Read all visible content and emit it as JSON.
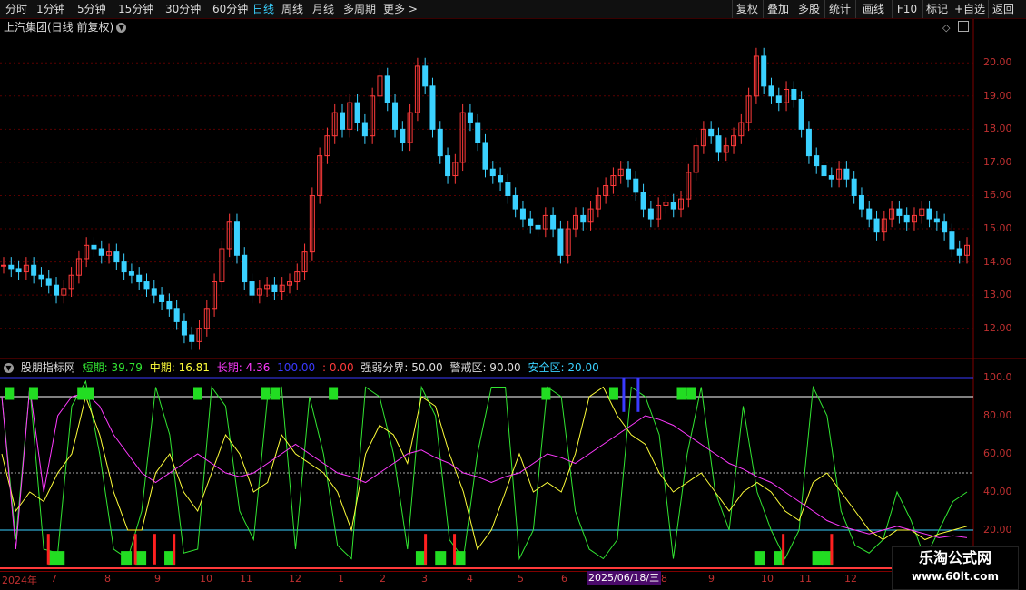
{
  "toolbar": {
    "periods": [
      "分时",
      "1分钟",
      "5分钟",
      "15分钟",
      "30分钟",
      "60分钟",
      "日线",
      "周线",
      "月线",
      "多周期",
      "更多 >"
    ],
    "active": "日线",
    "right_buttons": [
      "复权",
      "叠加",
      "多股",
      "统计",
      "画线",
      "F10",
      "标记",
      "+自选",
      "返回"
    ]
  },
  "chart": {
    "title": "上汽集团(日线 前复权)",
    "price_axis": [
      "20.00",
      "19.00",
      "18.00",
      "17.00",
      "16.00",
      "15.00",
      "14.00",
      "13.00",
      "12.00"
    ]
  },
  "indicator": {
    "name": "股朋指标网",
    "short_label": "短期: 39.79",
    "mid_label": "中期: 16.81",
    "long_label": "长期: 4.36",
    "blue_label": "100.00",
    "red_label": ": 0.00",
    "strong_label": "强弱分界: 50.00",
    "warn_label": "警戒区: 90.00",
    "safe_label": "安全区: 20.00",
    "axis": [
      "100.0",
      "80.00",
      "60.00",
      "40.00",
      "20.00"
    ]
  },
  "xaxis": {
    "labels": [
      "2024年",
      "7",
      "8",
      "9",
      "10",
      "11",
      "12",
      "1",
      "2",
      "3",
      "4",
      "5",
      "6",
      "8",
      "9",
      "10",
      "11",
      "12"
    ],
    "cursor": "2025/06/18/三"
  },
  "colors": {
    "up": "#ff3a3a",
    "down": "#3ad1ff",
    "short": "#32e632",
    "mid": "#ffff3a",
    "long": "#ff3aff",
    "grid": "#5a0000"
  },
  "watermark": {
    "line1": "乐淘公式网",
    "line2": "www.60lt.com"
  },
  "chart_data": [
    {
      "type": "candlestick",
      "title": "上汽集团(日线 前复权)",
      "ylim": [
        11.5,
        20.8
      ],
      "close": [
        13.9,
        13.8,
        13.7,
        13.9,
        13.6,
        13.5,
        13.3,
        13.0,
        13.2,
        13.6,
        14.1,
        14.5,
        14.4,
        14.2,
        14.3,
        14.0,
        13.7,
        13.6,
        13.4,
        13.2,
        13.0,
        12.8,
        12.6,
        12.2,
        11.8,
        11.6,
        12.0,
        12.6,
        13.4,
        14.4,
        15.2,
        14.2,
        13.4,
        13.0,
        13.2,
        13.3,
        13.1,
        13.3,
        13.4,
        13.7,
        14.3,
        16.0,
        17.2,
        17.8,
        18.5,
        18.0,
        18.8,
        18.2,
        17.8,
        19.0,
        19.6,
        18.8,
        18.0,
        17.6,
        18.5,
        19.9,
        19.3,
        18.0,
        17.2,
        16.6,
        17.0,
        18.5,
        18.2,
        17.6,
        16.8,
        16.6,
        16.4,
        16.0,
        15.6,
        15.3,
        15.1,
        15.0,
        15.4,
        15.0,
        14.2,
        15.0,
        15.4,
        15.2,
        15.6,
        16.0,
        16.3,
        16.6,
        16.8,
        16.5,
        16.1,
        15.6,
        15.3,
        15.7,
        15.8,
        15.6,
        15.9,
        16.7,
        17.5,
        18.0,
        17.8,
        17.3,
        17.5,
        17.8,
        18.2,
        19.0,
        20.2,
        19.3,
        19.0,
        18.8,
        19.2,
        18.9,
        18.0,
        17.2,
        16.9,
        16.6,
        16.5,
        16.8,
        16.5,
        16.0,
        15.6,
        15.3,
        14.9,
        15.3,
        15.6,
        15.4,
        15.2,
        15.4,
        15.6,
        15.3,
        15.2,
        14.9,
        14.4,
        14.2,
        14.5
      ]
    },
    {
      "type": "line",
      "title": "股朋指标网",
      "ylim": [
        0,
        100
      ],
      "series": [
        {
          "name": "短期",
          "values": [
            90,
            15,
            95,
            10,
            8,
            85,
            98,
            60,
            10,
            5,
            30,
            95,
            70,
            8,
            10,
            95,
            85,
            30,
            15,
            90,
            95,
            10,
            90,
            60,
            12,
            5,
            95,
            90,
            60,
            10,
            95,
            80,
            15,
            5,
            60,
            95,
            95,
            5,
            20,
            95,
            90,
            30,
            10,
            5,
            15,
            95,
            90,
            70,
            5,
            60,
            95,
            40,
            20,
            85,
            40,
            20,
            5,
            20,
            95,
            80,
            30,
            12,
            8,
            15,
            40,
            25,
            5,
            20,
            35,
            40
          ]
        },
        {
          "name": "中期",
          "values": [
            60,
            30,
            40,
            35,
            50,
            60,
            90,
            70,
            40,
            20,
            20,
            50,
            60,
            40,
            30,
            50,
            70,
            60,
            40,
            45,
            70,
            60,
            55,
            50,
            40,
            20,
            60,
            75,
            70,
            55,
            90,
            85,
            60,
            40,
            10,
            20,
            40,
            60,
            40,
            45,
            40,
            60,
            90,
            95,
            80,
            70,
            65,
            50,
            40,
            45,
            50,
            40,
            30,
            40,
            45,
            40,
            30,
            25,
            45,
            50,
            40,
            30,
            20,
            15,
            20,
            20,
            15,
            18,
            20,
            22
          ]
        },
        {
          "name": "长期",
          "values": [
            90,
            10,
            95,
            40,
            80,
            90,
            92,
            85,
            70,
            60,
            50,
            45,
            50,
            55,
            60,
            55,
            50,
            48,
            50,
            55,
            60,
            65,
            60,
            55,
            50,
            48,
            45,
            50,
            55,
            60,
            62,
            58,
            55,
            50,
            48,
            45,
            48,
            50,
            55,
            60,
            58,
            55,
            60,
            65,
            70,
            75,
            80,
            78,
            75,
            70,
            65,
            60,
            55,
            52,
            48,
            45,
            40,
            35,
            30,
            25,
            22,
            20,
            18,
            20,
            22,
            20,
            18,
            16,
            17,
            16
          ]
        }
      ]
    }
  ]
}
